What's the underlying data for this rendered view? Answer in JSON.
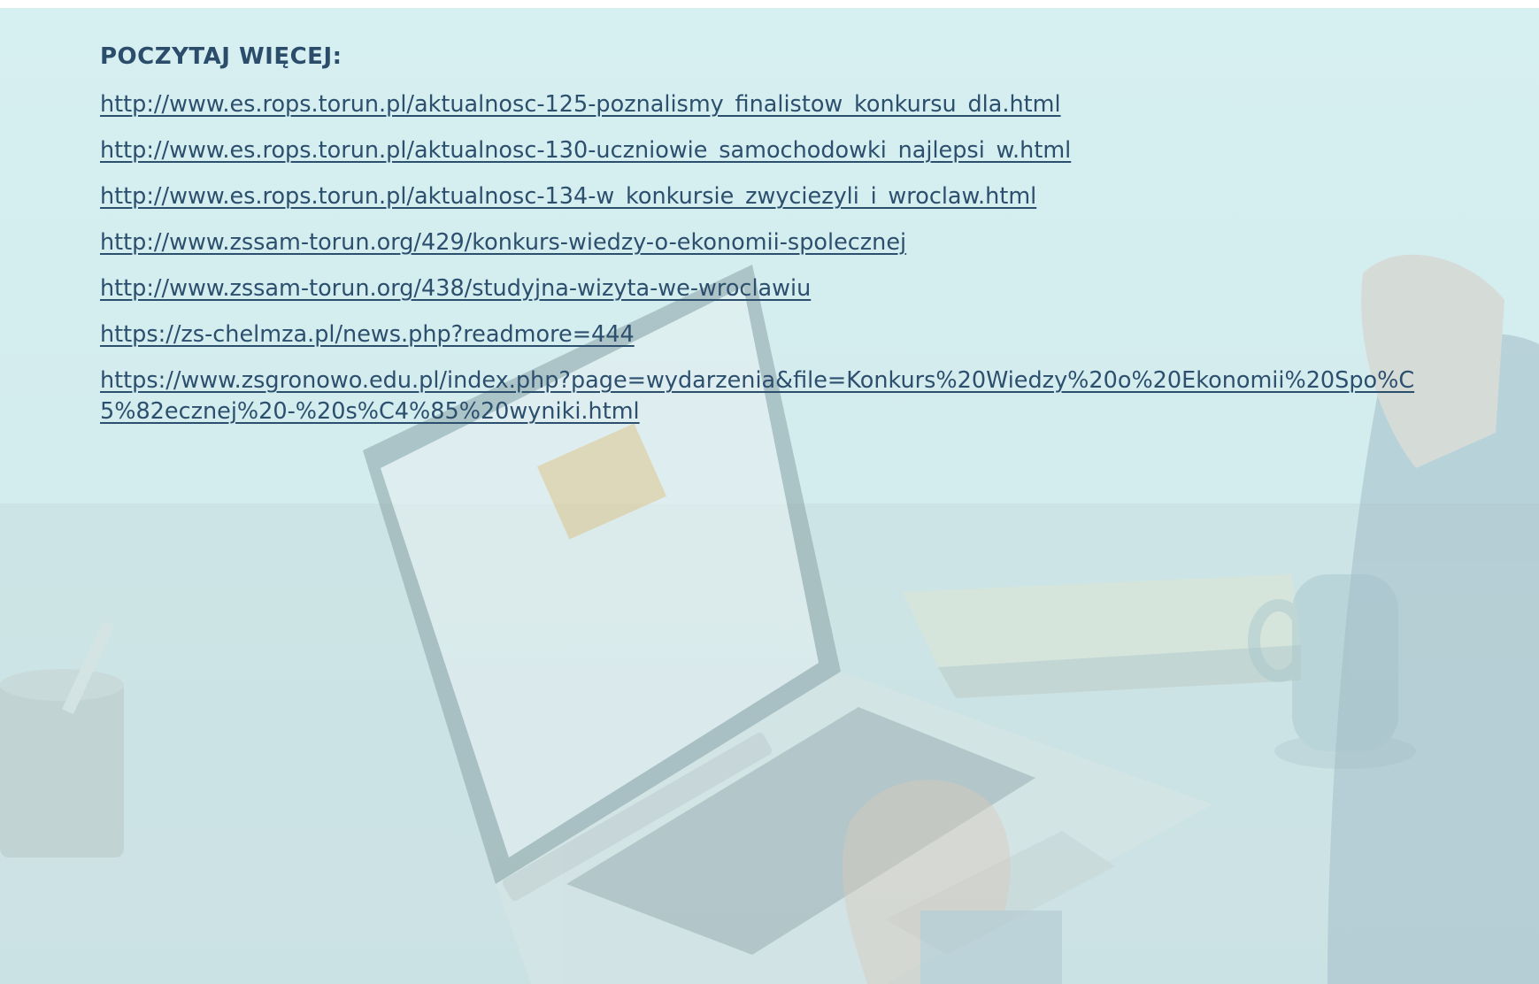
{
  "section": {
    "heading": "POCZYTAJ WIĘCEJ:"
  },
  "links": [
    {
      "text": "http://www.es.rops.torun.pl/aktualnosc-125-poznalismy_finalistow_konkursu_dla.html"
    },
    {
      "text": "http://www.es.rops.torun.pl/aktualnosc-130-uczniowie_samochodowki_najlepsi_w.html"
    },
    {
      "text": "http://www.es.rops.torun.pl/aktualnosc-134-w_konkursie_zwyciezyli_i_wroclaw.html"
    },
    {
      "text": "http://www.zssam-torun.org/429/konkurs-wiedzy-o-ekonomii-spolecznej"
    },
    {
      "text": "http://www.zssam-torun.org/438/studyjna-wizyta-we-wroclawiu"
    },
    {
      "text": "https://zs-chelmza.pl/news.php?readmore=444"
    },
    {
      "text": "https://www.zsgronowo.edu.pl/index.php?page=wydarzenia&file=Konkurs%20Wiedzy%20o%20Ekonomii%20Spo%C5%82ecznej%20-%20s%C4%85%20wyniki.html"
    }
  ],
  "colors": {
    "background_tint": "#d6eff0",
    "heading": "#2b4d6b",
    "link": "#2d4f6e"
  },
  "background_image": "laptop-on-desk-photo"
}
